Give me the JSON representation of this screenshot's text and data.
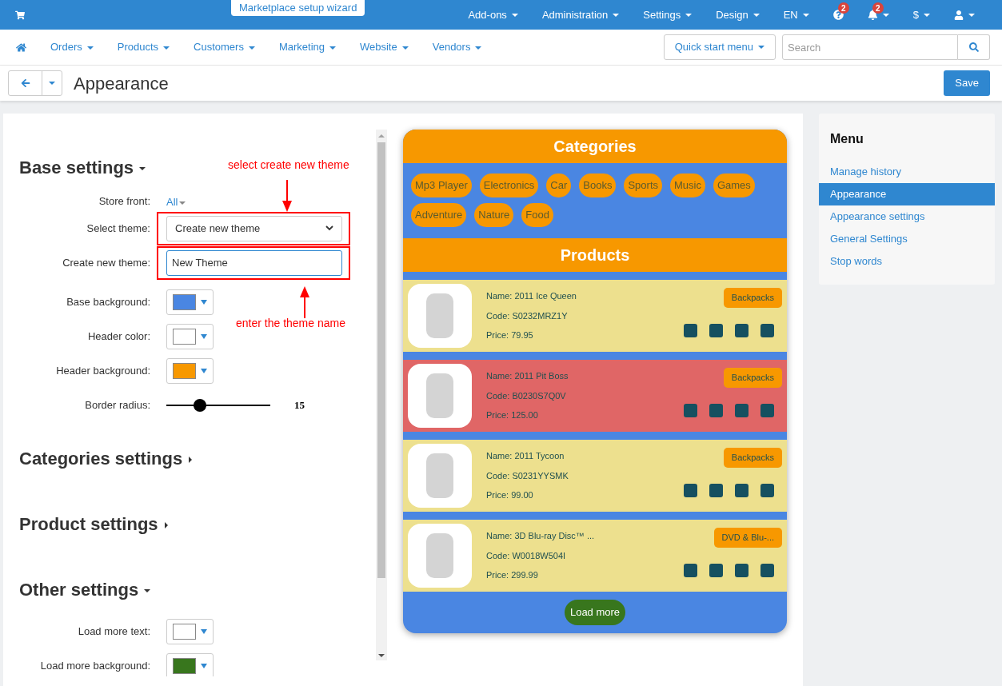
{
  "top_bar": {
    "wizard": "Marketplace setup wizard",
    "items": [
      {
        "kind": "text",
        "label": "Add-ons"
      },
      {
        "kind": "text",
        "label": "Administration"
      },
      {
        "kind": "text",
        "label": "Settings"
      },
      {
        "kind": "text",
        "label": "Design"
      },
      {
        "kind": "text",
        "label": "EN"
      },
      {
        "kind": "help",
        "badge": "2"
      },
      {
        "kind": "bell",
        "badge": "2"
      },
      {
        "kind": "text",
        "label": "$"
      },
      {
        "kind": "user"
      }
    ]
  },
  "nav": {
    "items": [
      "Orders",
      "Products",
      "Customers",
      "Marketing",
      "Website",
      "Vendors"
    ],
    "quick_start": "Quick start menu",
    "search": {
      "placeholder": "Search"
    }
  },
  "page": {
    "title": "Appearance",
    "save": "Save"
  },
  "settings": {
    "sections": [
      {
        "title": "Base settings",
        "expanded": true,
        "fields": [
          {
            "kind": "link",
            "label": "Store front:",
            "value": "All"
          },
          {
            "kind": "select",
            "label": "Select theme:",
            "value": "Create new theme",
            "flagged": true
          },
          {
            "kind": "text",
            "label": "Create new theme:",
            "value": "New Theme",
            "flagged": true
          },
          {
            "kind": "color",
            "label": "Base background:",
            "color": "#4a86e2"
          },
          {
            "kind": "color",
            "label": "Header color:",
            "color": "#ffffff"
          },
          {
            "kind": "color",
            "label": "Header background:",
            "color": "#f79800"
          },
          {
            "kind": "slider",
            "label": "Border radius:",
            "level": 0.32,
            "reading": "15"
          }
        ]
      },
      {
        "title": "Categories settings",
        "expanded": false
      },
      {
        "title": "Product settings",
        "expanded": false
      },
      {
        "title": "Other settings",
        "expanded": true,
        "fields": [
          {
            "kind": "color",
            "label": "Load more text:",
            "color": "#ffffff"
          },
          {
            "kind": "color",
            "label": "Load more background:",
            "color": "#38761d"
          }
        ]
      }
    ],
    "annotations": [
      "select create new theme",
      "enter the theme name"
    ]
  },
  "preview": {
    "categories_title": "Categories",
    "categories": [
      "Mp3 Player",
      "Electronics",
      "Car",
      "Books",
      "Sports",
      "Music",
      "Games",
      "Adventure",
      "Nature",
      "Food"
    ],
    "products_title": "Products",
    "products": [
      {
        "name": "Name: 2011 Ice Queen",
        "code": "Code: S0232MRZ1Y",
        "price": "Price: 79.95",
        "category": "Backpacks",
        "highlighted": false
      },
      {
        "name": "Name: 2011 Pit Boss",
        "code": "Code: B0230S7Q0V",
        "price": "Price: 125.00",
        "category": "Backpacks",
        "highlighted": true
      },
      {
        "name": "Name: 2011 Tycoon",
        "code": "Code: S0231YYSMK",
        "price": "Price: 99.00",
        "category": "Backpacks",
        "highlighted": false
      },
      {
        "name": "Name: 3D Blu-ray Disc™ ...",
        "code": "Code: W0018W504I",
        "price": "Price: 299.99",
        "category": "DVD & Blu-...",
        "highlighted": false
      }
    ],
    "load_more": "Load more"
  },
  "menu": {
    "title": "Menu",
    "items": [
      {
        "label": "Manage history",
        "selected": false
      },
      {
        "label": "Appearance",
        "selected": true
      },
      {
        "label": "Appearance settings",
        "selected": false
      },
      {
        "label": "General Settings",
        "selected": false
      },
      {
        "label": "Stop words",
        "selected": false
      }
    ]
  }
}
